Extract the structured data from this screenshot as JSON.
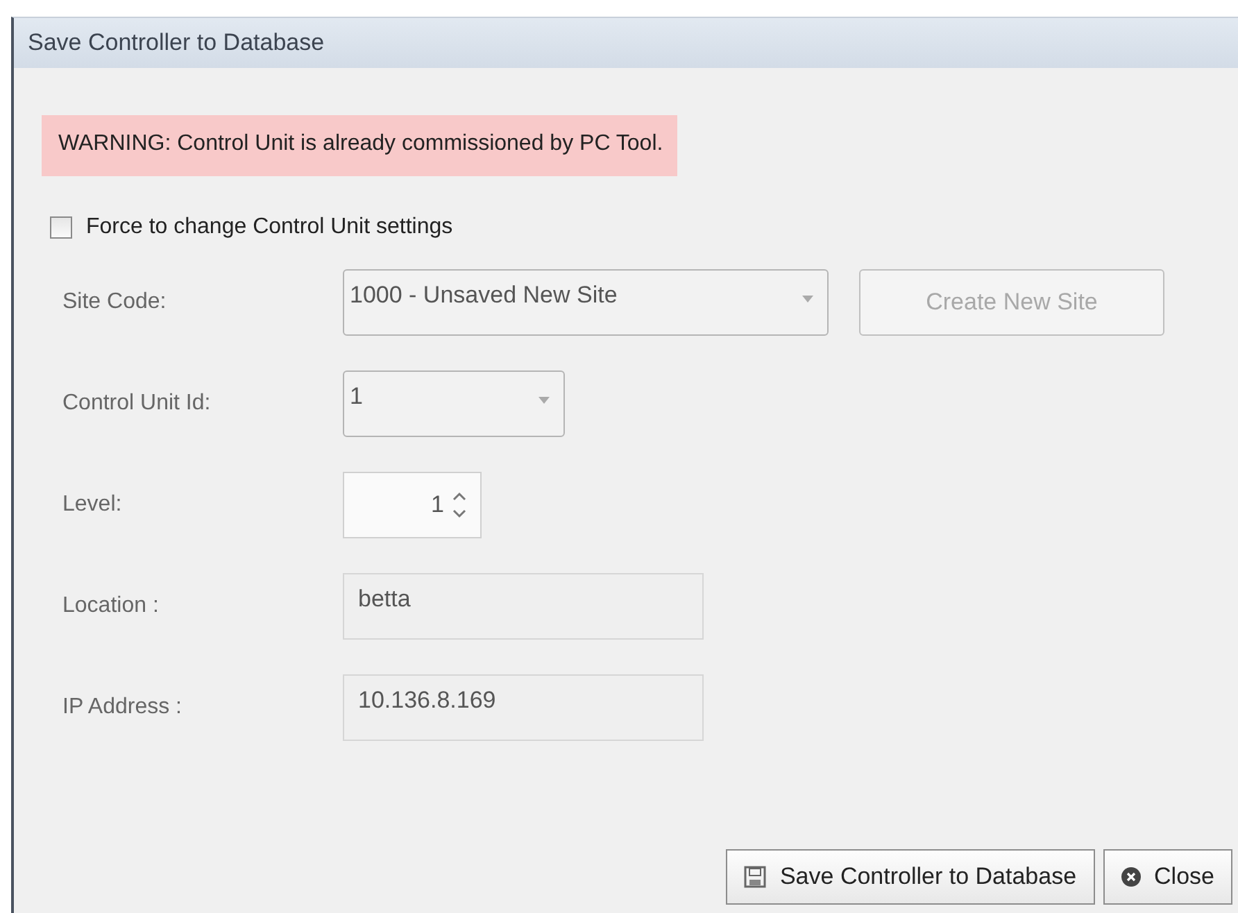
{
  "window": {
    "title": "Save Controller to Database"
  },
  "warning": "WARNING: Control Unit is already commissioned by PC Tool.",
  "force_checkbox": {
    "label": "Force to change Control Unit settings",
    "checked": false
  },
  "fields": [
    {
      "kind": "combo",
      "label": "Site Code:",
      "value": "1000 - Unsaved New Site",
      "action": {
        "label": "Create New Site",
        "disabled": true
      }
    },
    {
      "kind": "combo",
      "label": "Control Unit Id:",
      "value": "1"
    },
    {
      "kind": "spinner",
      "label": "Level:",
      "value": "1"
    },
    {
      "kind": "text",
      "label": "Location :",
      "value": "betta"
    },
    {
      "kind": "text",
      "label": "IP Address :",
      "value": "10.136.8.169"
    }
  ],
  "buttons": [
    {
      "kind": "save",
      "label": "Save Controller to Database"
    },
    {
      "kind": "close",
      "label": "Close"
    }
  ]
}
